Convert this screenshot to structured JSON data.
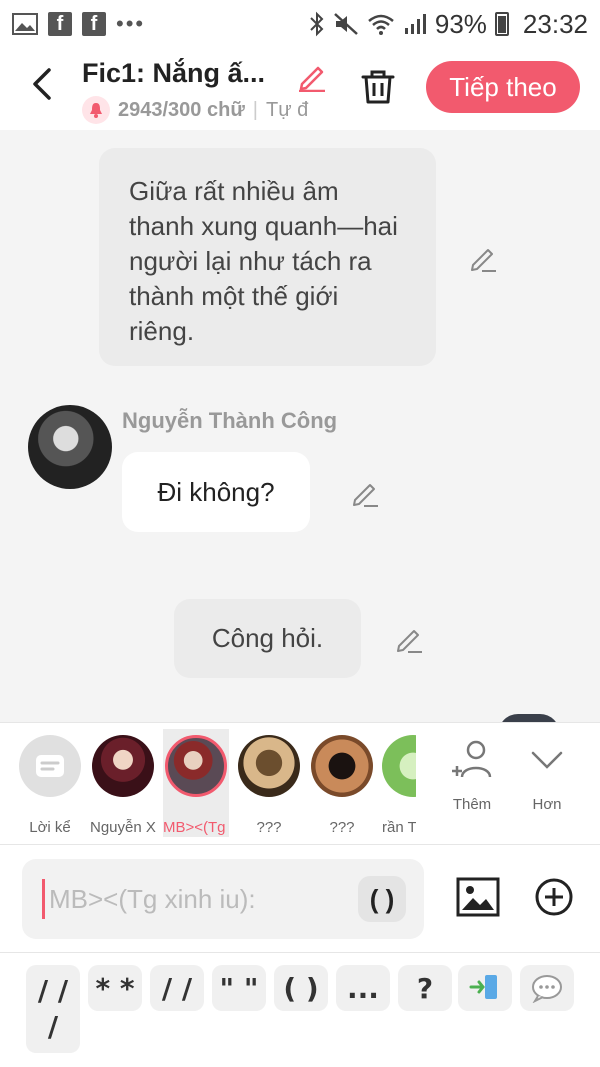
{
  "status_bar": {
    "battery": "93%",
    "time": "23:32",
    "left_icons": [
      "gallery-icon",
      "facebook-icon",
      "facebook-icon",
      "more-dots-icon"
    ],
    "right_icons": [
      "bluetooth-icon",
      "mute-icon",
      "wifi-icon",
      "signal-icon",
      "battery-icon"
    ]
  },
  "header": {
    "title": "Fic1: Nắng ấ...",
    "word_count": "2943/300 chữ",
    "subtitle_extra": "Tự đ",
    "next_button": "Tiếp theo",
    "accent_color": "#f25a6e"
  },
  "chat": {
    "narration_1": "Giữa rất nhiều âm thanh xung quanh—hai người lại như tách ra thành một thế giới riêng.",
    "sender_name": "Nguyễn Thành Công",
    "message_1": "Đi không?",
    "narration_2": "Công hỏi."
  },
  "characters": [
    {
      "label": "Lời kể",
      "icon": "narrator-icon",
      "selected": false
    },
    {
      "label": "Nguyễn X...",
      "icon": "avatar",
      "selected": false
    },
    {
      "label": "MB><(Tg x...",
      "icon": "avatar",
      "selected": true
    },
    {
      "label": "???",
      "icon": "silhouette-avatar",
      "selected": false
    },
    {
      "label": "???",
      "icon": "silhouette-avatar",
      "selected": false
    },
    {
      "label": "rần T",
      "icon": "avatar",
      "selected": false
    }
  ],
  "actions": {
    "add_label": "Thêm",
    "more_label": "Hơn"
  },
  "input": {
    "placeholder": "MB><(Tg xinh iu):",
    "paren_button": "( )"
  },
  "symbols": [
    "/ / /",
    "* *",
    "/ /",
    "\" \"",
    "( )",
    "...",
    "?"
  ]
}
